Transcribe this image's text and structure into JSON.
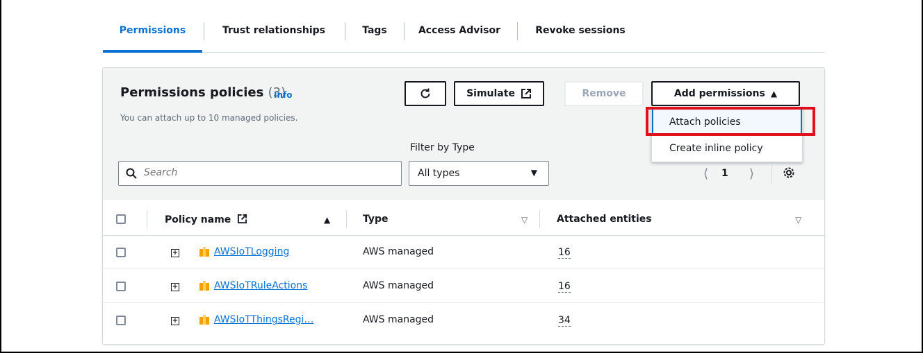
{
  "tabs": [
    {
      "label": "Permissions"
    },
    {
      "label": "Trust relationships"
    },
    {
      "label": "Tags"
    },
    {
      "label": "Access Advisor"
    },
    {
      "label": "Revoke sessions"
    }
  ],
  "panel": {
    "title": "Permissions policies",
    "count": "(3)",
    "info": "Info",
    "subtitle": "You can attach up to 10 managed policies."
  },
  "toolbar": {
    "refresh_icon": "refresh-icon",
    "simulate_label": "Simulate",
    "remove_label": "Remove",
    "add_permissions_label": "Add permissions"
  },
  "dropdown": {
    "items": [
      {
        "label": "Attach policies"
      },
      {
        "label": "Create inline policy"
      }
    ]
  },
  "filter": {
    "label": "Filter by Type",
    "search_placeholder": "Search",
    "type_value": "All types"
  },
  "pagination": {
    "page": "1"
  },
  "table": {
    "columns": [
      "Policy name",
      "Type",
      "Attached entities"
    ],
    "rows": [
      {
        "name": "AWSIoTLogging",
        "type": "AWS managed",
        "entities": "16"
      },
      {
        "name": "AWSIoTRuleActions",
        "type": "AWS managed",
        "entities": "16"
      },
      {
        "name": "AWSIoTThingsRegi…",
        "type": "AWS managed",
        "entities": "34"
      }
    ]
  },
  "colors": {
    "accent": "#0972d3",
    "highlight": "#e0111f",
    "policy_icon": "#f5a200"
  }
}
